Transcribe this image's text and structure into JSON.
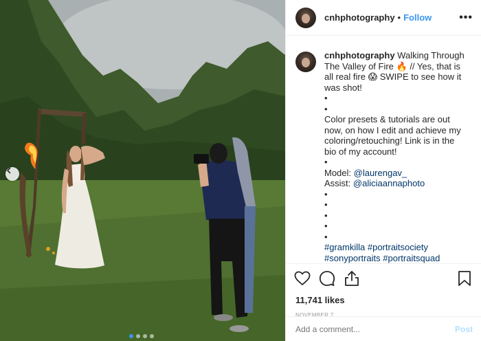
{
  "post": {
    "username": "cnhphotography",
    "follow_label": "Follow",
    "more_label": "•••",
    "separator": "•"
  },
  "caption": {
    "username": "cnhphotography",
    "lines": [
      "Walking Through The Valley of Fire 🔥 // Yes, that is all real fire 😱 SWIPE to see how it was shot!",
      "•",
      "•",
      "Color presets & tutorials are out now, on how I edit and achieve my coloring/retouching! Link is in the bio of my account!",
      "•"
    ],
    "model_label": "Model: ",
    "model_handle": "@laurengav_",
    "assist_label": "Assist: ",
    "assist_handle": "@aliciaannaphoto",
    "dots_after": [
      "•",
      "•",
      "•",
      "•",
      "•"
    ],
    "hashtags_line1": "#gramkilla #portraitsociety",
    "hashtags_line2": "#sonyportraits #portraitsquad"
  },
  "stats": {
    "likes": "11,741 likes",
    "date": "NOVEMBER 7"
  },
  "composer": {
    "placeholder": "Add a comment...",
    "post_label": "Post"
  },
  "icons": {
    "like": "heart-icon",
    "comment": "comment-icon",
    "share": "share-icon",
    "save": "bookmark-icon",
    "prev": "chevron-left-icon"
  },
  "colors": {
    "link": "#003569",
    "follow": "#3897f0",
    "post_disabled": "#b2dffc"
  }
}
